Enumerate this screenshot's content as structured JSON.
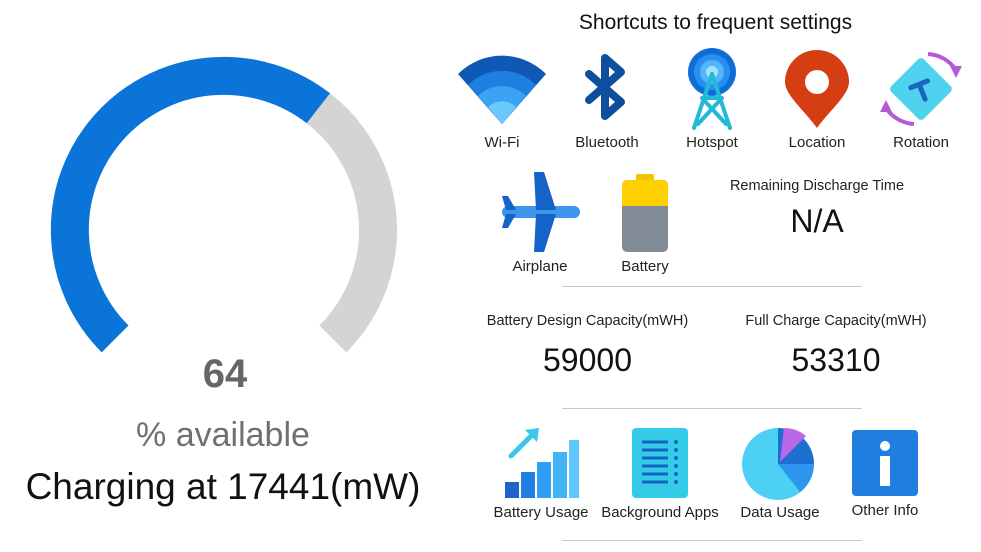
{
  "gauge": {
    "percent": 64,
    "value_text": "64",
    "unit_text": "% available",
    "status_text": "Charging at 17441(mW)",
    "fill_color": "#0b74d8",
    "track_color": "#d4d4d4"
  },
  "shortcuts": {
    "title": "Shortcuts to frequent settings",
    "row1": [
      {
        "label": "Wi-Fi",
        "icon": "wifi-icon"
      },
      {
        "label": "Bluetooth",
        "icon": "bluetooth-icon"
      },
      {
        "label": "Hotspot",
        "icon": "hotspot-icon"
      },
      {
        "label": "Location",
        "icon": "location-icon"
      },
      {
        "label": "Rotation",
        "icon": "rotation-icon"
      }
    ],
    "row2": [
      {
        "label": "Airplane",
        "icon": "airplane-icon"
      },
      {
        "label": "Battery",
        "icon": "battery-icon"
      }
    ]
  },
  "discharge": {
    "title": "Remaining Discharge Time",
    "value": "N/A"
  },
  "capacity": {
    "design_title": "Battery Design Capacity(mWH)",
    "design_value": "59000",
    "full_title": "Full Charge Capacity(mWH)",
    "full_value": "53310"
  },
  "tools": [
    {
      "label": "Battery Usage",
      "icon": "battery-usage-chart-icon"
    },
    {
      "label": "Background Apps",
      "icon": "background-apps-icon"
    },
    {
      "label": "Data Usage",
      "icon": "pie-chart-icon"
    },
    {
      "label": "Other Info",
      "icon": "info-icon"
    }
  ]
}
